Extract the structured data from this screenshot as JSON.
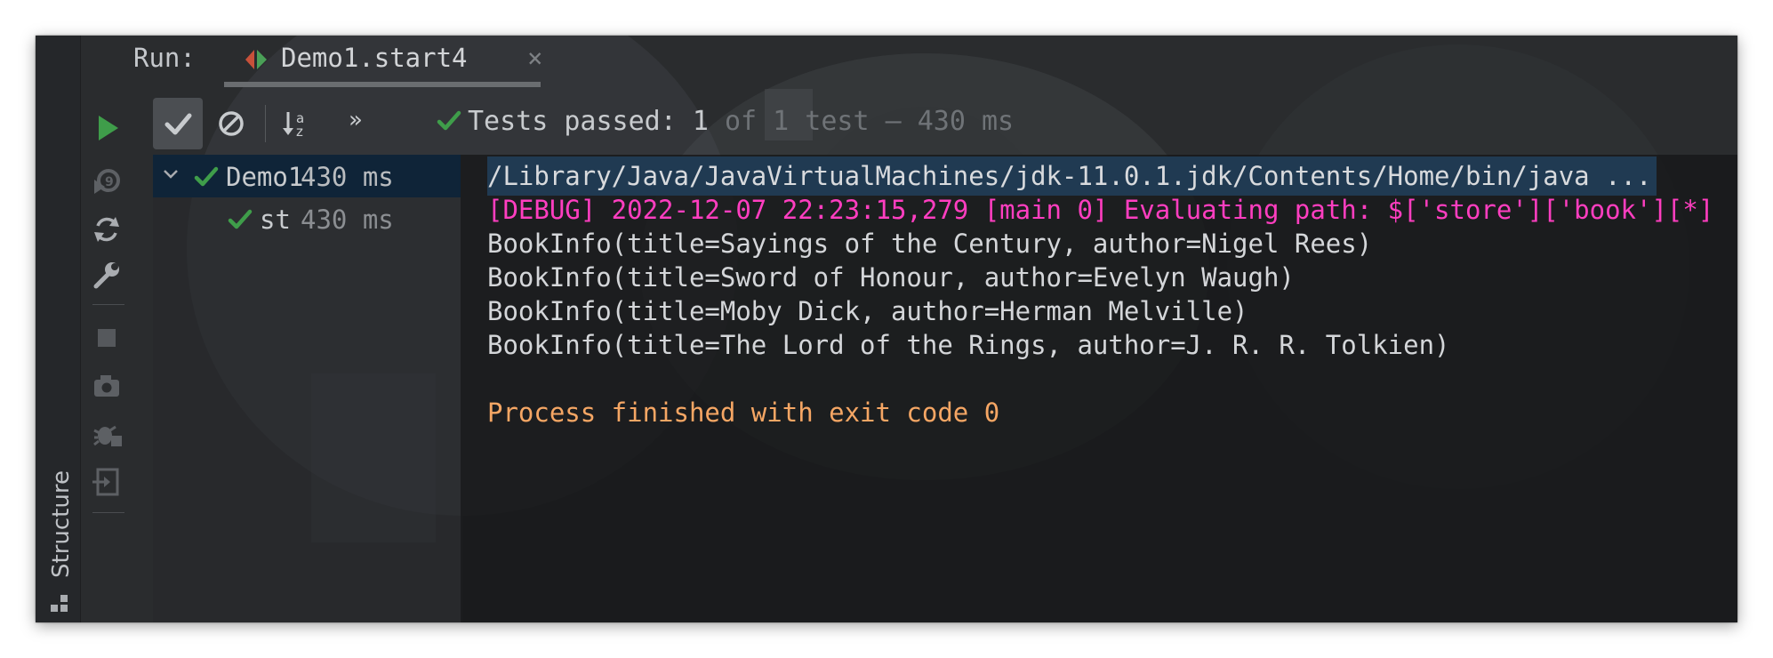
{
  "window": {
    "run_label": "Run:",
    "tab_label": "Demo1.start4",
    "tab_close": "×"
  },
  "sidebar": {
    "structure_label": "Structure"
  },
  "toolbar": {
    "icons": [
      "run-icon",
      "rerun-failed-icon",
      "rerun-icon",
      "settings-wrench-icon",
      "stop-icon",
      "screenshot-icon",
      "debug-icon",
      "exit-icon"
    ],
    "test_buttons": [
      "show-passed-icon",
      "show-ignored-icon",
      "sort-alpha-icon",
      "more-chevron-icon"
    ],
    "more_label": "»"
  },
  "status": {
    "label": "Tests passed:",
    "passed": "1",
    "detail": "of 1 test – 430 ms"
  },
  "tree": {
    "items": [
      {
        "name": "Demo1",
        "time": "430 ms",
        "expanded": true,
        "selected": true,
        "passed": true
      },
      {
        "name": "st",
        "time": "430 ms",
        "expanded": false,
        "selected": false,
        "passed": true
      }
    ]
  },
  "console": {
    "lines": [
      {
        "kind": "cmd",
        "text": "/Library/Java/JavaVirtualMachines/jdk-11.0.1.jdk/Contents/Home/bin/java ..."
      },
      {
        "kind": "debug",
        "text": "[DEBUG] 2022-12-07 22:23:15,279 [main 0] Evaluating path: $['store']['book'][*]"
      },
      {
        "kind": "out",
        "text": "BookInfo(title=Sayings of the Century, author=Nigel Rees)"
      },
      {
        "kind": "out",
        "text": "BookInfo(title=Sword of Honour, author=Evelyn Waugh)"
      },
      {
        "kind": "out",
        "text": "BookInfo(title=Moby Dick, author=Herman Melville)"
      },
      {
        "kind": "out",
        "text": "BookInfo(title=The Lord of the Rings, author=J. R. R. Tolkien)"
      },
      {
        "kind": "blank",
        "text": ""
      },
      {
        "kind": "exit",
        "text": "Process finished with exit code 0"
      }
    ]
  },
  "colors": {
    "pass_green": "#3f9d4a",
    "debug_magenta": "#ff3ec0",
    "exit_orange": "#f5a664",
    "selection_blue": "#0f2438"
  }
}
